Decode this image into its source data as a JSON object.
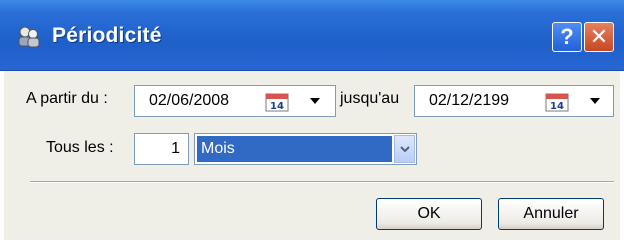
{
  "window": {
    "title": "Périodicité",
    "help_label": "?",
    "close_label": "✕"
  },
  "form": {
    "from_label": "A partir du :",
    "from_date": "02/06/2008",
    "until_label": "jusqu'au",
    "until_date": "02/12/2199",
    "calendar_day": "14",
    "every_label": "Tous les :",
    "every_value": "1",
    "unit_value": "Mois"
  },
  "buttons": {
    "ok_label": "OK",
    "cancel_label": "Annuler"
  },
  "colors": {
    "titlebar": "#2a6fd8",
    "selection": "#316ac5",
    "close_button": "#c84722"
  },
  "icons": {
    "title": "people-icon",
    "calendar": "calendar-icon",
    "dropdown": "chevron-down-icon"
  }
}
